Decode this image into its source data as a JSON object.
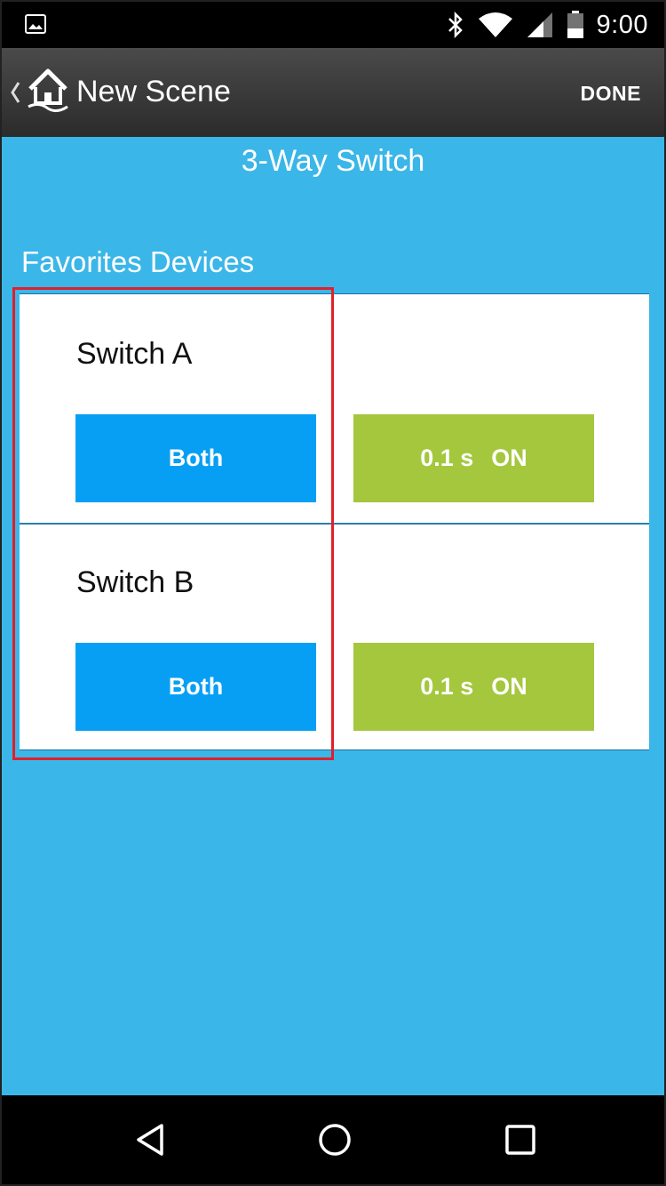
{
  "status_bar": {
    "time": "9:00",
    "icons": [
      "image-icon",
      "bluetooth-icon",
      "wifi-icon",
      "signal-icon",
      "battery-icon"
    ]
  },
  "app_bar": {
    "title": "New Scene",
    "done_label": "DONE",
    "icons": [
      "back-chevron-icon",
      "home-logo-icon"
    ]
  },
  "scene": {
    "name": "3-Way Switch"
  },
  "favorites": {
    "section_title": "Favorites Devices",
    "devices": [
      {
        "name": "Switch A",
        "mode_label": "Both",
        "delay": "0.1 s",
        "state": "ON"
      },
      {
        "name": "Switch B",
        "mode_label": "Both",
        "delay": "0.1 s",
        "state": "ON"
      }
    ]
  },
  "nav_bar": {
    "icons": [
      "back-triangle-icon",
      "home-circle-icon",
      "recents-square-icon"
    ]
  },
  "colors": {
    "background": "#3bb6e8",
    "mode_button": "#079ff4",
    "state_button": "#a4c73e",
    "highlight": "#e0202a"
  }
}
